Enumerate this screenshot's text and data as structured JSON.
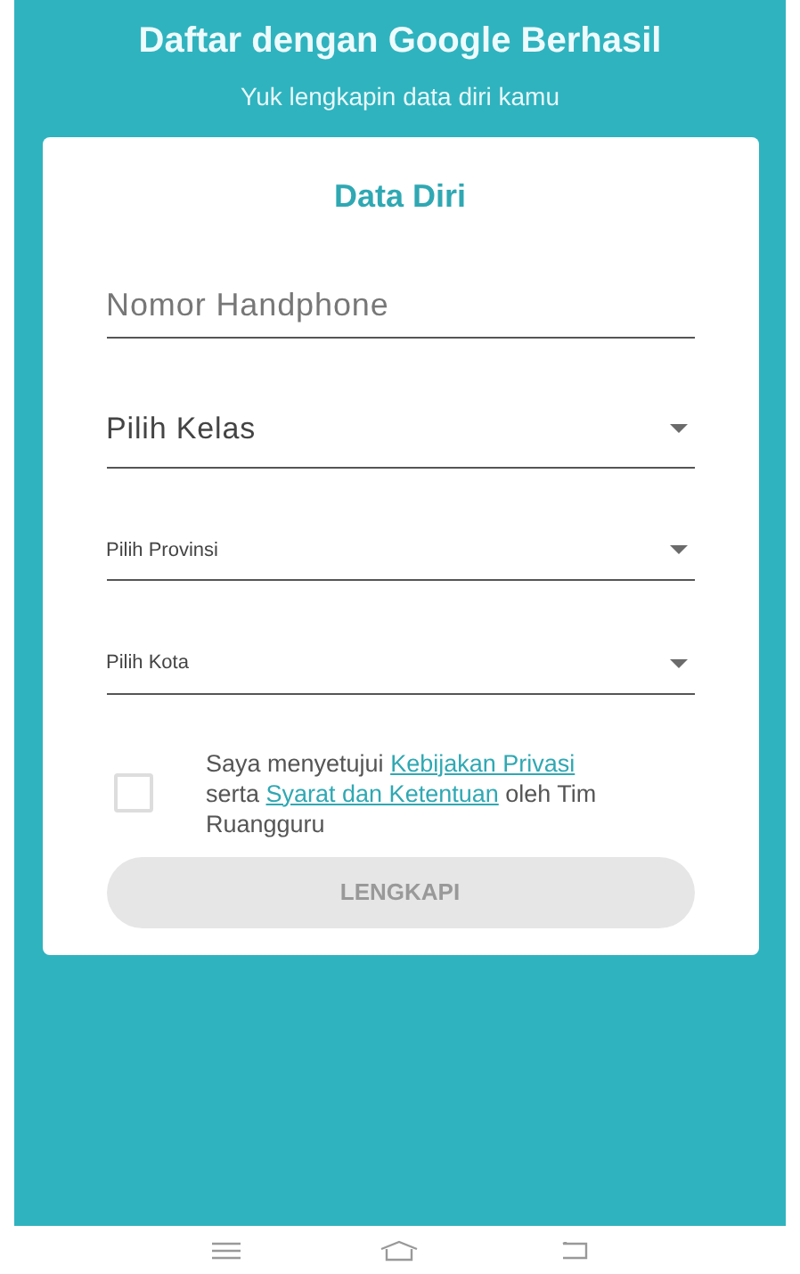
{
  "header": {
    "title": "Daftar dengan Google Berhasil",
    "subtitle": "Yuk lengkapin data diri kamu"
  },
  "form": {
    "title": "Data Diri",
    "fields": [
      {
        "kind": "input",
        "placeholder": "Nomor Handphone"
      },
      {
        "kind": "dropdown",
        "label": "Pilih Kelas"
      },
      {
        "kind": "compact-dropdown",
        "label": "Pilih Provinsi"
      },
      {
        "kind": "compact-dropdown",
        "label": "Pilih Kota"
      }
    ],
    "consent": {
      "checked": false,
      "parts": [
        {
          "kind": "text",
          "text": "Saya menyetujui "
        },
        {
          "kind": "link",
          "text": "Kebijakan Privasi"
        },
        {
          "kind": "text",
          "text": " serta "
        },
        {
          "kind": "link",
          "text": "Syarat dan Ketentuan"
        },
        {
          "kind": "text",
          "text": " oleh Tim Ruangguru"
        }
      ]
    },
    "submit": {
      "label": "LENGKAPI",
      "disabled": true
    }
  }
}
